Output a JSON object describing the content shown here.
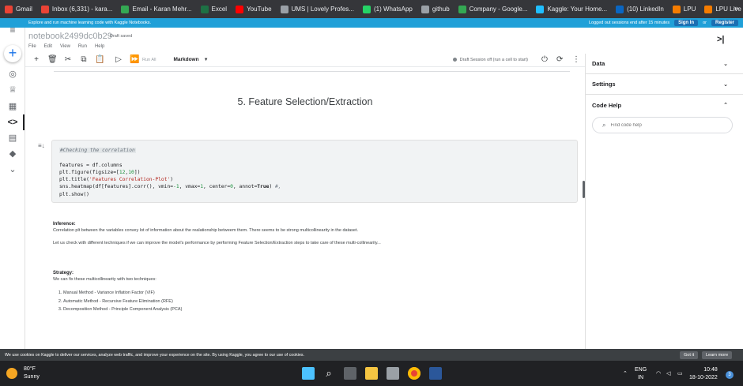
{
  "bookmarks": [
    {
      "label": "Gmail",
      "color": "#ea4335"
    },
    {
      "label": "Inbox (6,331) - kara...",
      "color": "#ea4335"
    },
    {
      "label": "Email - Karan Mehr...",
      "color": "#34a853"
    },
    {
      "label": "Excel",
      "color": "#1e7145"
    },
    {
      "label": "YouTube",
      "color": "#ff0000"
    },
    {
      "label": "UMS | Lovely Profes...",
      "color": "#9aa0a6"
    },
    {
      "label": "(1) WhatsApp",
      "color": "#25d366"
    },
    {
      "label": "github",
      "color": "#9aa0a6"
    },
    {
      "label": "Company - Google...",
      "color": "#34a853"
    },
    {
      "label": "Kaggle: Your Home...",
      "color": "#20beff"
    },
    {
      "label": "(10) LinkedIn",
      "color": "#0a66c2"
    },
    {
      "label": "LPU",
      "color": "#f57c00"
    },
    {
      "label": "LPU Live",
      "color": "#f57c00"
    }
  ],
  "bookmarks_more": "»",
  "banner": {
    "text": "Explore and run machine learning code with Kaggle Notebooks.",
    "session_notice": "Logged out sessions end after 15 minutes",
    "sign_in": "Sign In",
    "or": "or",
    "register": "Register"
  },
  "notebook": {
    "title": "notebook2499dc0b29",
    "status": "Draft saved",
    "menu": [
      "File",
      "Edit",
      "View",
      "Run",
      "Help"
    ]
  },
  "toolbar": {
    "run_all": "Run All",
    "cell_mode": "Markdown",
    "session": "Draft Session off (run a cell to start)"
  },
  "cells": {
    "heading": "5. Feature Selection/Extraction",
    "code_comment": "#Checking the correlation",
    "code": {
      "l1": "features = df.columns",
      "l2a": "plt.figure(figsize=[",
      "l2b": "12",
      "l2c": ",",
      "l2d": "10",
      "l2e": "])",
      "l3a": "plt.title(",
      "l3b": "'Features Correlation-Plot'",
      "l3c": ")",
      "l4a": "sns.heatmap(df[features].corr(), vmin=",
      "l4b": "-1",
      "l4c": ", vmax=",
      "l4d": "1",
      "l4e": ", center=",
      "l4f": "0",
      "l4g": ", annot=",
      "l4h": "True",
      "l4i": ") ",
      "l4j": "#,",
      "l5": "plt.show()"
    },
    "inference_title": "Inference:",
    "inference_p1": "Correlation plt between the variables convey lot of information about the realationship betweem them. There seems to be strong multicollinearity in the dataset.",
    "inference_p2": "Let us check with different techniques if we can improve the model's performance by performing Feature Selection/Extraction steps to take care of these multi-collinearity...",
    "strategy_title": "Strategy:",
    "strategy_intro": "We can fix these multicollinearity with two techniques:",
    "strategy_items": [
      "Manual Method - Variance Inflation Factor (VIF)",
      "Automatic Method - Recursive Feature Elimination (RFE)",
      "Decomposition Method - Principle Component Analysis (PCA)"
    ]
  },
  "right_panel": {
    "data": "Data",
    "settings": "Settings",
    "code_help": "Code Help",
    "search_placeholder": "Find code help"
  },
  "cookie": {
    "text": "We use cookies on Kaggle to deliver our services, analyze web traffic, and improve your experience on the site. By using Kaggle, you agree to our use of cookies.",
    "got_it": "Got it",
    "learn_more": "Learn more"
  },
  "taskbar": {
    "temp": "80°F",
    "weather": "Sunny",
    "lang1": "ENG",
    "lang2": "IN",
    "time": "10:48",
    "date": "18-10-2022",
    "notifications": "3"
  }
}
